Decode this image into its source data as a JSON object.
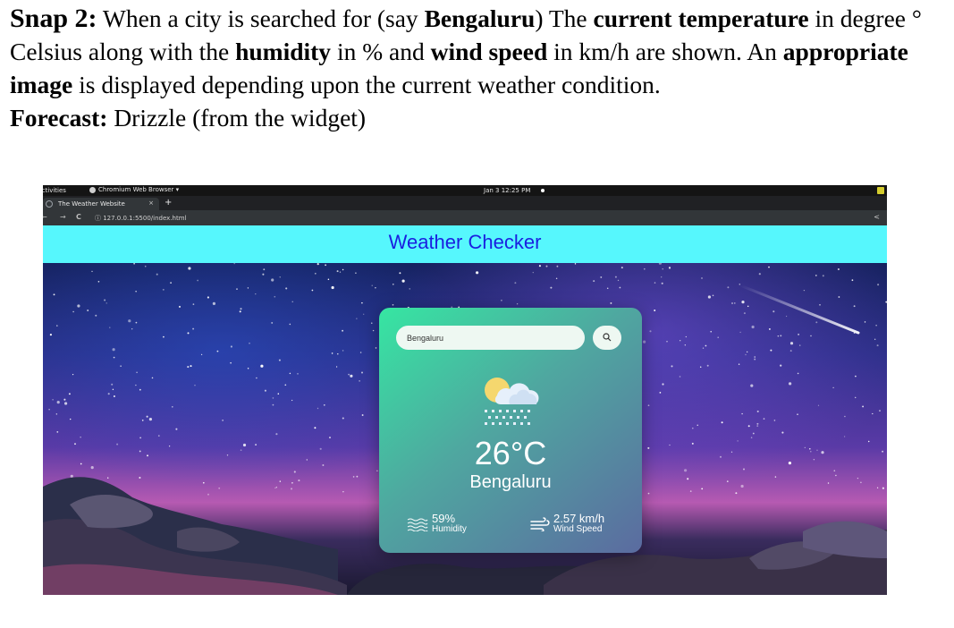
{
  "document": {
    "line1": {
      "b1": "Snap 2:",
      "t1": " When a city is searched for (say ",
      "b2": "Bengaluru",
      "t2": ") The ",
      "b3": "current temperature",
      "t3": " in degree °"
    },
    "line2": {
      "t1": "Celsius along with the ",
      "b1": "humidity",
      "t2": " in % and ",
      "b2": "wind speed",
      "t3": " in km/h are shown. An ",
      "b3": "appropriate"
    },
    "line3": {
      "b1": "image",
      "t1": " is displayed depending upon the current weather condition."
    },
    "line4": {
      "b1": "Forecast:",
      "t1": " Drizzle (from the widget)"
    }
  },
  "desktop": {
    "activities": "Activities",
    "app_name": "Chromium Web Browser ▾",
    "clock": "Jan 3  12:25 PM"
  },
  "browser": {
    "tab_title": "The Weather Website",
    "tab_close": "×",
    "new_tab": "+",
    "back": "←",
    "forward": "→",
    "reload": "C",
    "url": "ⓘ  127.0.0.1:5500/index.html",
    "share": "<"
  },
  "app": {
    "title": "Weather Checker",
    "search_value": "Bengaluru",
    "weather_icon": "drizzle-icon",
    "temperature": "26°C",
    "city": "Bengaluru",
    "humidity_value": "59%",
    "humidity_label": "Humidity",
    "wind_value": "2.57 km/h",
    "wind_label": "Wind Speed"
  },
  "colors": {
    "header_bg": "#56f7fd",
    "title_color": "#1a1fe0",
    "card_gradient_start": "#36e6a2",
    "card_gradient_end": "#5b6ba0"
  }
}
